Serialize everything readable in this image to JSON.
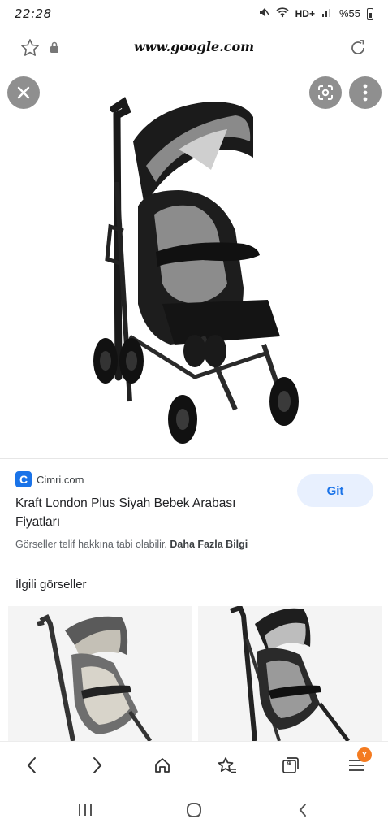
{
  "status_bar": {
    "time": "22:28",
    "network": "HD+",
    "battery": "%55"
  },
  "browser": {
    "url": "www.google.com"
  },
  "result": {
    "source_name": "Cimri.com",
    "source_letter": "C",
    "title": "Kraft London Plus Siyah Bebek Arabası Fiyatları",
    "visit_label": "Git",
    "copyright_text": "Görseller telif hakkına tabi olabilir.",
    "more_info_label": "Daha Fazla Bilgi"
  },
  "related": {
    "heading": "İlgili görseller"
  },
  "bottom_nav": {
    "tab_count": "4",
    "badge_letter": "Y"
  },
  "colors": {
    "accent": "#1a73e8",
    "button_bg": "#e8f0fe",
    "badge": "#f47b20"
  },
  "icons": [
    "star-icon",
    "lock-icon",
    "reload-icon",
    "close-icon",
    "lens-icon",
    "more-vert-icon",
    "back-icon",
    "forward-icon",
    "home-icon",
    "bookmark-star-icon",
    "tabs-icon",
    "menu-icon",
    "recents-icon",
    "home-circle-icon",
    "system-back-icon"
  ]
}
